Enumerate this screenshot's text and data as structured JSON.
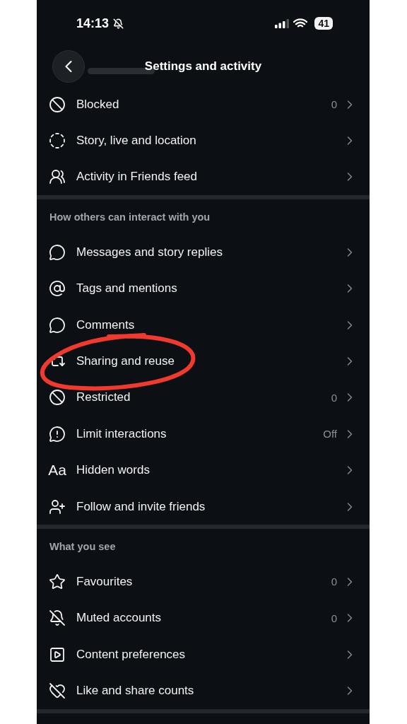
{
  "status_bar": {
    "time": "14:13",
    "battery": "41"
  },
  "header": {
    "title": "Settings and activity"
  },
  "sections": [
    {
      "items": [
        {
          "label": "Blocked",
          "value": "0"
        },
        {
          "label": "Story, live and location"
        },
        {
          "label": "Activity in Friends feed"
        }
      ]
    },
    {
      "title": "How others can interact with you",
      "items": [
        {
          "label": "Messages and story replies"
        },
        {
          "label": "Tags and mentions"
        },
        {
          "label": "Comments"
        },
        {
          "label": "Sharing and reuse"
        },
        {
          "label": "Restricted",
          "value": "0"
        },
        {
          "label": "Limit interactions",
          "value": "Off"
        },
        {
          "label": "Hidden words",
          "icon_glyph": "Aa"
        },
        {
          "label": "Follow and invite friends"
        }
      ]
    },
    {
      "title": "What you see",
      "items": [
        {
          "label": "Favourites",
          "value": "0"
        },
        {
          "label": "Muted accounts",
          "value": "0"
        },
        {
          "label": "Content preferences"
        },
        {
          "label": "Like and share counts"
        }
      ]
    }
  ]
}
